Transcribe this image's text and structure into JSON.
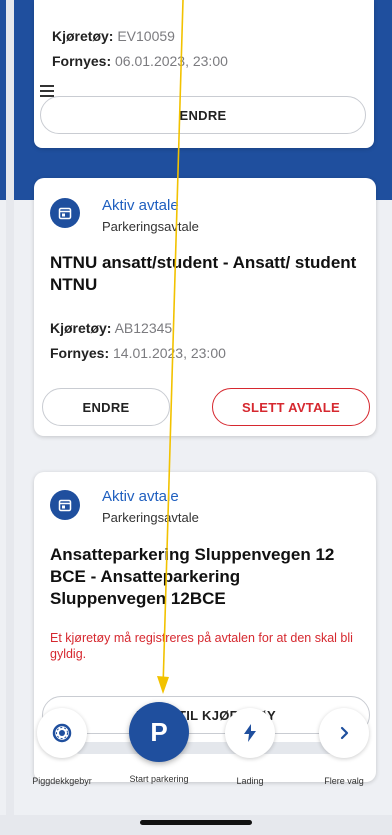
{
  "card_top": {
    "vehicle_label": "Kjøretøy:",
    "vehicle_value": "EV10059",
    "renew_label": "Fornyes:",
    "renew_value": "06.01.2023, 23:00",
    "edit_button": "ENDRE"
  },
  "card_agreement_1": {
    "status": "Aktiv avtale",
    "type": "Parkeringsavtale",
    "title": "NTNU ansatt/student - Ansatt/ student NTNU",
    "vehicle_label": "Kjøretøy:",
    "vehicle_value": "AB12345",
    "renew_label": "Fornyes:",
    "renew_value": "14.01.2023, 23:00",
    "edit_button": "ENDRE",
    "delete_button": "SLETT AVTALE"
  },
  "card_agreement_2": {
    "status": "Aktiv avtale",
    "type": "Parkeringsavtale",
    "title": "Ansatteparkering Sluppenvegen 12 BCE - Ansatteparkering Sluppenvegen 12BCE",
    "warning": "Et kjøretøy må registreres på avtalen for at den skal bli gyldig.",
    "add_vehicle_button": "LEGG TIL KJØRETØY"
  },
  "tabs": [
    {
      "label": "Piggdekkgebyr",
      "icon": "tire-icon"
    },
    {
      "label": "Start parkering",
      "icon": "parking-p-icon",
      "glyph": "P"
    },
    {
      "label": "Lading",
      "icon": "lightning-icon"
    },
    {
      "label": "Flere valg",
      "icon": "chevron-right-icon"
    }
  ],
  "colors": {
    "brand_blue": "#1f4f9e",
    "link_blue": "#1f5fbf",
    "danger_red": "#d6282f",
    "annotation_yellow": "#f2c200"
  }
}
